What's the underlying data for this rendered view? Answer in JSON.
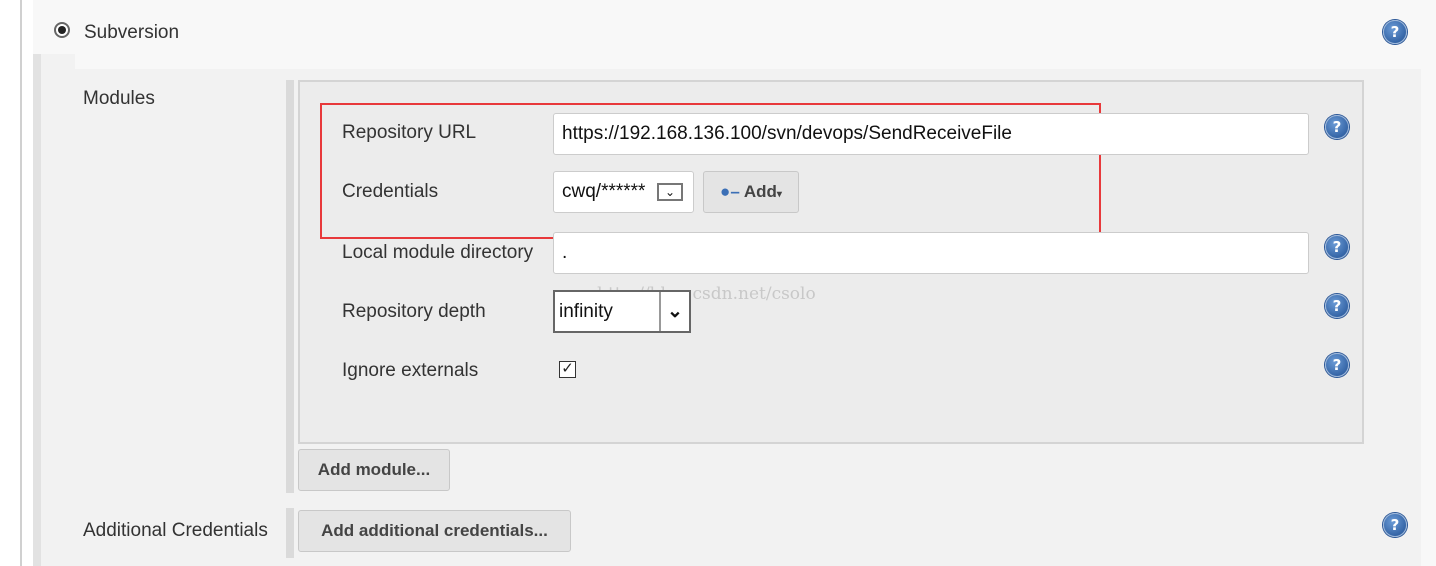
{
  "scm": {
    "option_label": "Subversion",
    "selected": true
  },
  "modules": {
    "label": "Modules",
    "repository_url": {
      "label": "Repository URL",
      "value": "https://192.168.136.100/svn/devops/SendReceiveFile"
    },
    "credentials": {
      "label": "Credentials",
      "value": "cwq/******",
      "add_label": "Add"
    },
    "local_module_directory": {
      "label": "Local module directory",
      "value": "."
    },
    "repository_depth": {
      "label": "Repository depth",
      "value": "infinity"
    },
    "ignore_externals": {
      "label": "Ignore externals",
      "checked": true
    },
    "add_module_label": "Add module..."
  },
  "additional_credentials": {
    "label": "Additional Credentials",
    "button_label": "Add additional credentials..."
  },
  "watermark": "http://blog.csdn.net/csolo",
  "highlight_color": "#e8393b"
}
